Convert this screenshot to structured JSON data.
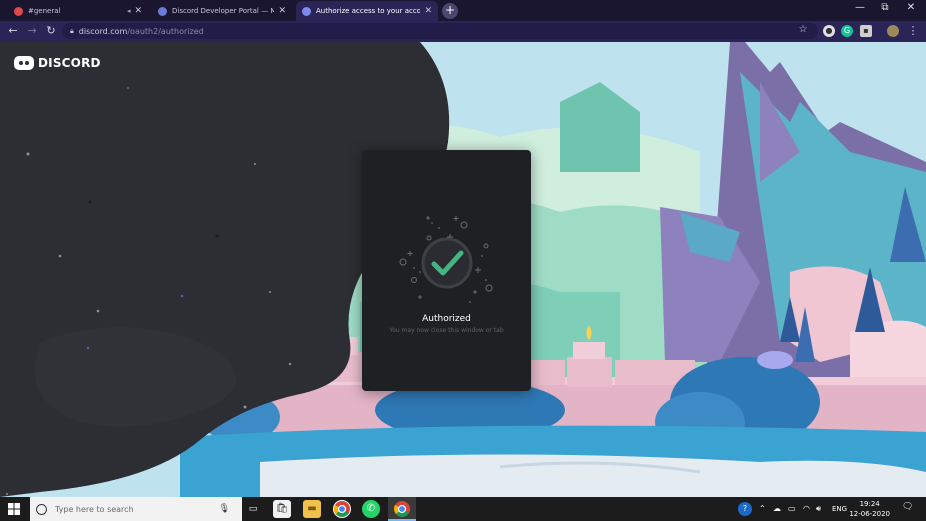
{
  "tabs": [
    {
      "title": "#general",
      "favicon_color": "#e04848",
      "active": false
    },
    {
      "title": "Discord Developer Portal — My",
      "favicon_color": "#6b7bd8",
      "active": false
    },
    {
      "title": "Authorize access to your account",
      "favicon_color": "#7d8bf0",
      "active": true
    }
  ],
  "window_controls": {
    "minimize": "—",
    "restore": "⧉",
    "close": "✕"
  },
  "address_bar": {
    "host": "discord.com",
    "path": "/oauth2/authorized"
  },
  "toolbar_icons": {
    "back": "←",
    "forward": "→",
    "reload": "↻",
    "star": "☆",
    "menu": "⋮"
  },
  "page": {
    "logo_text": "DISCORD",
    "modal": {
      "title": "Authorized",
      "subtitle": "You may now close this window or tab"
    }
  },
  "colors": {
    "accent": "#43b581",
    "modal_bg": "#1f2024",
    "blob": "#2c2e33"
  },
  "taskbar": {
    "search_placeholder": "Type here to search",
    "language": "ENG",
    "time": "19:24",
    "date": "12-06-2020"
  }
}
